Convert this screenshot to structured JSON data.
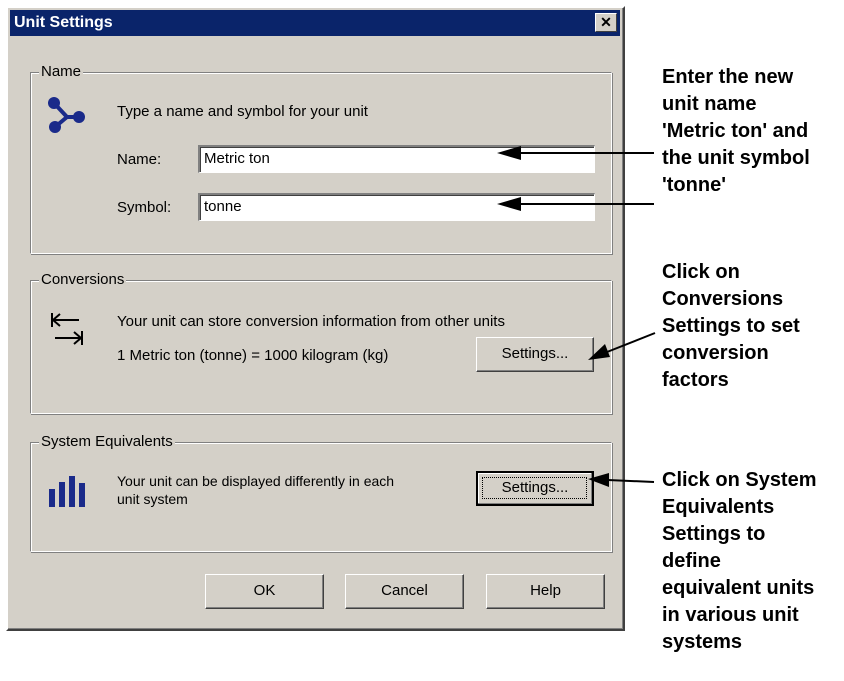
{
  "dialog": {
    "title": "Unit Settings",
    "close_label": "✕",
    "name_group": {
      "label": "Name",
      "prompt": "Type a name and symbol for your unit",
      "name_label": "Name:",
      "name_value": "Metric ton",
      "symbol_label": "Symbol:",
      "symbol_value": "tonne",
      "icon": "molecule-icon"
    },
    "conversions_group": {
      "label": "Conversions",
      "description": "Your unit can store conversion information from other units",
      "conversion_text": "1 Metric ton (tonne) = 1000 kilogram (kg)",
      "settings_label": "Settings...",
      "icon": "conversion-arrows-icon"
    },
    "system_group": {
      "label": "System Equivalents",
      "description_line1": "Your unit can be displayed differently in each",
      "description_line2": "unit system",
      "settings_label": "Settings...",
      "icon": "bars-icon"
    },
    "buttons": {
      "ok": "OK",
      "cancel": "Cancel",
      "help": "Help"
    }
  },
  "annotations": {
    "name": [
      "Enter the new",
      "unit name",
      "'Metric ton' and",
      "the unit symbol",
      "'tonne'"
    ],
    "conversions": [
      "Click on",
      "Conversions",
      "Settings to set",
      "conversion",
      "factors"
    ],
    "system": [
      "Click on System",
      "Equivalents",
      "Settings to",
      "define",
      "equivalent units",
      "in various unit",
      "systems"
    ]
  },
  "colors": {
    "titlebar": "#0a246a",
    "face": "#d4d0c8",
    "icon_blue": "#1a2a8a"
  }
}
